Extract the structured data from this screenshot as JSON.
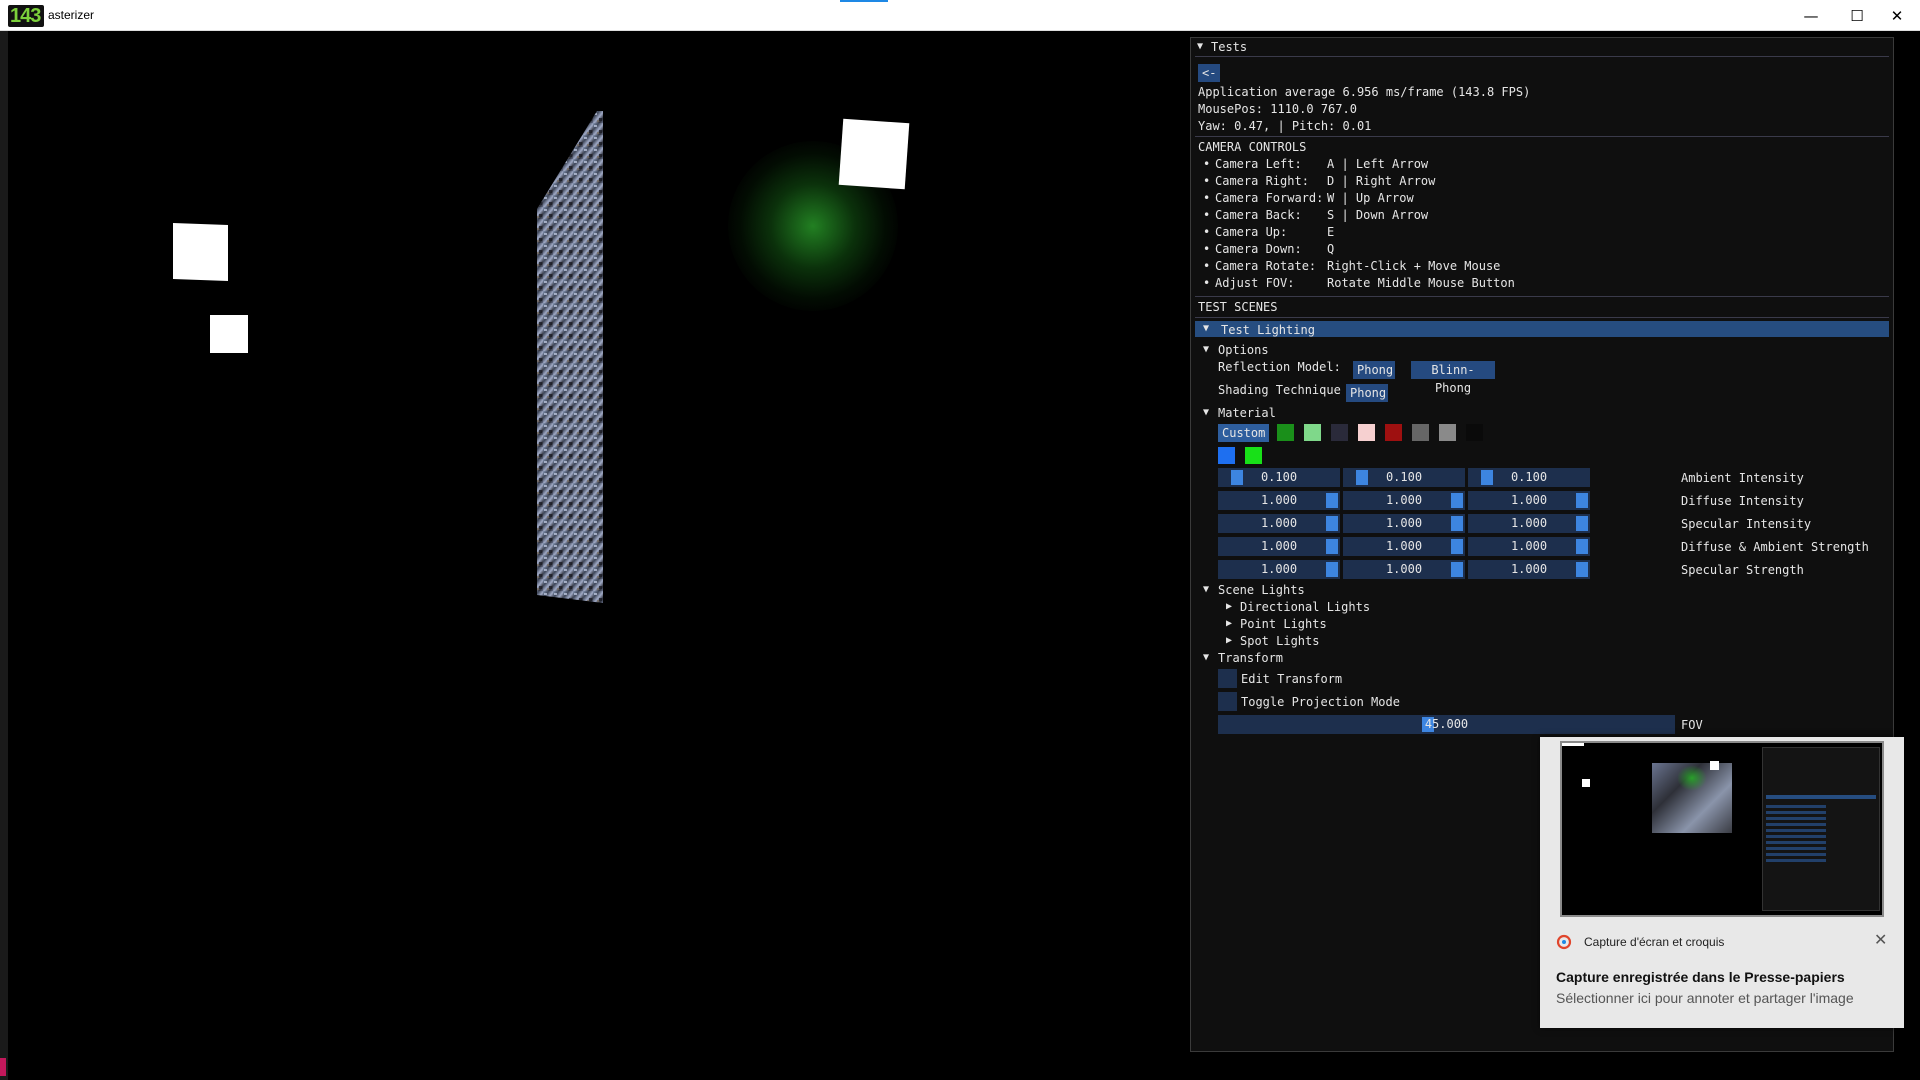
{
  "window": {
    "title": "asterizer",
    "icon_fps": "143",
    "controls": {
      "minimize": "—",
      "maximize": "☐",
      "close": "✕"
    }
  },
  "panel": {
    "header": "Tests",
    "back_button": "<-",
    "stats": {
      "average": "Application average 6.956 ms/frame (143.8 FPS)",
      "mouse": "MousePos: 1110.0 767.0",
      "yaw_pitch": "Yaw: 0.47, | Pitch: 0.01"
    },
    "camera_controls": {
      "title": "CAMERA CONTROLS",
      "items": [
        {
          "label": "Camera Left:",
          "keys": "A | Left Arrow"
        },
        {
          "label": "Camera Right:",
          "keys": "D | Right Arrow"
        },
        {
          "label": "Camera Forward:",
          "keys": "W | Up Arrow"
        },
        {
          "label": "Camera Back:",
          "keys": "S | Down Arrow"
        },
        {
          "label": "Camera Up:",
          "keys": "E"
        },
        {
          "label": "Camera Down:",
          "keys": "Q"
        },
        {
          "label": "Camera Rotate:",
          "keys": "Right-Click + Move Mouse"
        },
        {
          "label": "Adjust FOV:",
          "keys": "Rotate Middle Mouse Button"
        }
      ]
    },
    "test_scenes": {
      "title": "TEST SCENES",
      "selected": "Test Lighting"
    },
    "options": {
      "title": "Options",
      "reflection_label": "Reflection Model:",
      "reflection_phong": "Phong",
      "reflection_blinn": "Blinn-Phong",
      "shading_label": "Shading Technique",
      "shading_value": "Phong"
    },
    "material": {
      "title": "Material",
      "custom_button": "Custom",
      "swatches": [
        "#1a8f1a",
        "#7fd88a",
        "#2a2a3a",
        "#f6d0d0",
        "#9e1010",
        "#666666",
        "#8a8a8a",
        "#0a0a0a"
      ],
      "swatches_row2": [
        "#1e6ff0",
        "#18e018"
      ],
      "rows": [
        {
          "label": "Ambient Intensity",
          "values": [
            "0.100",
            "0.100",
            "0.100"
          ],
          "level": 0.1
        },
        {
          "label": "Diffuse Intensity",
          "values": [
            "1.000",
            "1.000",
            "1.000"
          ],
          "level": 1.0
        },
        {
          "label": "Specular Intensity",
          "values": [
            "1.000",
            "1.000",
            "1.000"
          ],
          "level": 1.0
        },
        {
          "label": "Diffuse & Ambient Strength",
          "values": [
            "1.000",
            "1.000",
            "1.000"
          ],
          "level": 1.0
        },
        {
          "label": "Specular Strength",
          "values": [
            "1.000",
            "1.000",
            "1.000"
          ],
          "level": 1.0
        }
      ]
    },
    "scene_lights": {
      "title": "Scene Lights",
      "items": [
        "Directional Lights",
        "Point Lights",
        "Spot Lights"
      ]
    },
    "transform": {
      "title": "Transform",
      "edit": "Edit Transform",
      "toggle": "Toggle Projection Mode",
      "fov_value": "45.000",
      "fov_label": "FOV"
    }
  },
  "toast": {
    "source": "Capture d'écran et croquis",
    "title": "Capture enregistrée dans le Presse-papiers",
    "subtitle": "Sélectionner ici pour annoter et partager l'image",
    "close": "✕"
  },
  "colors": {
    "panel_bg": "#0f0f0f",
    "header_blue": "#264d80",
    "button_blue": "#254a80",
    "slider_bg": "#1d2f4d",
    "grab_blue": "#3d85e0"
  }
}
